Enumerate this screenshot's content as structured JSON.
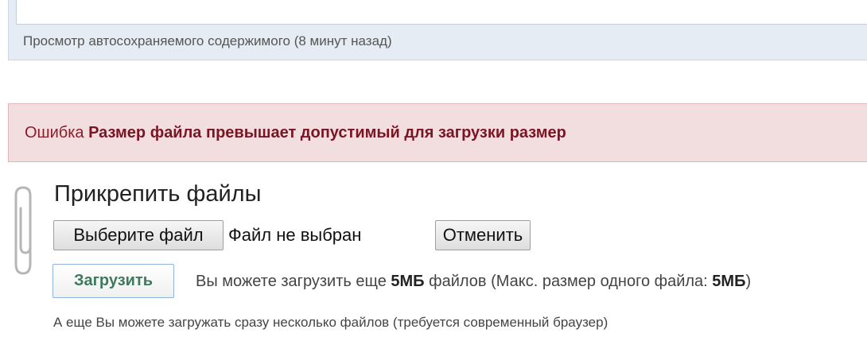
{
  "autosave": {
    "preview_link": "Просмотр автосохраняемого содержимого (8 минут назад)"
  },
  "error": {
    "label": "Ошибка",
    "message": "Размер файла превышает допустимый для загрузки размер"
  },
  "attach": {
    "title": "Прикрепить файлы",
    "choose_button": "Выберите файл",
    "no_file_text": "Файл не выбран",
    "cancel_button": "Отменить",
    "upload_button": "Загрузить",
    "limits_prefix": "Вы можете загрузить еще",
    "limits_remaining": "5МБ",
    "limits_middle": "файлов (Макс. размер одного файла:",
    "limits_max": "5МБ",
    "limits_suffix": ")",
    "multi_note": "А еще Вы можете загружать сразу несколько файлов (требуется современный браузер)"
  },
  "icons": {
    "attach": "paperclip-icon"
  },
  "colors": {
    "error_bg": "#f2dede",
    "error_text": "#8c1b2b",
    "upload_text": "#3f7a5e",
    "editor_bg": "#e6ecf4"
  }
}
